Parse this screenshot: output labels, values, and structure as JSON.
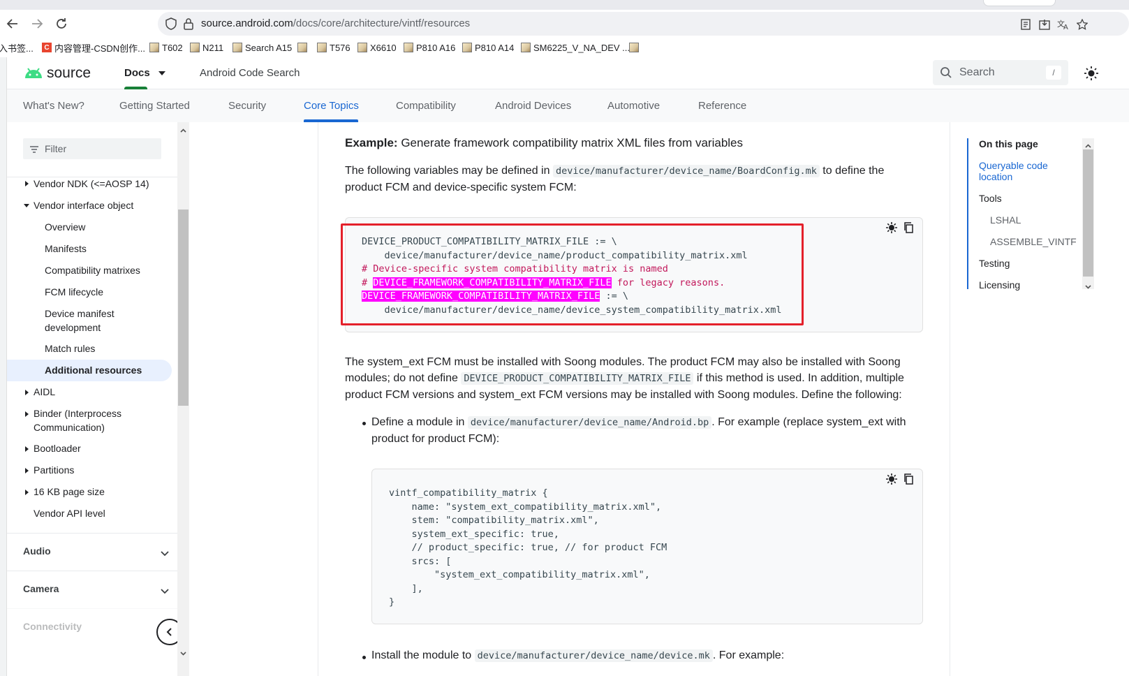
{
  "browser": {
    "url_host": "source.android.com",
    "url_path": "/docs/core/architecture/vintf/resources",
    "bookmarks": [
      {
        "label": "入书签...",
        "type": "plain"
      },
      {
        "label": "内容管理-CSDN创作...",
        "type": "csdn"
      },
      {
        "label": "T602",
        "type": "img"
      },
      {
        "label": "N211",
        "type": "img"
      },
      {
        "label": "Search A15",
        "type": "img"
      },
      {
        "label": "",
        "type": "img"
      },
      {
        "label": "T576",
        "type": "img"
      },
      {
        "label": "X6610",
        "type": "img"
      },
      {
        "label": "P810 A16",
        "type": "img"
      },
      {
        "label": "P810 A14",
        "type": "img"
      },
      {
        "label": "SM6225_V_NA_DEV ...",
        "type": "img"
      },
      {
        "label": "",
        "type": "img"
      }
    ]
  },
  "header": {
    "logo_text": "source",
    "docs_label": "Docs",
    "code_search": "Android Code Search",
    "search_placeholder": "Search",
    "search_shortcut": "/"
  },
  "topnav": {
    "items": [
      "What's New?",
      "Getting Started",
      "Security",
      "Core Topics",
      "Compatibility",
      "Android Devices",
      "Automotive",
      "Reference"
    ],
    "active": "Core Topics"
  },
  "sidebar": {
    "filter_placeholder": "Filter",
    "items": [
      {
        "label": "Vendor NDK (<=AOSP 14)"
      },
      {
        "label": "Vendor interface object"
      },
      {
        "label": "Overview"
      },
      {
        "label": "Manifests"
      },
      {
        "label": "Compatibility matrixes"
      },
      {
        "label": "FCM lifecycle"
      },
      {
        "label": "Device manifest development",
        "line1": "Device manifest",
        "line2": "development"
      },
      {
        "label": "Match rules"
      },
      {
        "label": "Additional resources"
      },
      {
        "label": "AIDL"
      },
      {
        "label": "Binder (Interprocess Communication)",
        "line1": "Binder (Interprocess",
        "line2": "Communication)"
      },
      {
        "label": "Bootloader"
      },
      {
        "label": "Partitions"
      },
      {
        "label": "16 KB page size"
      },
      {
        "label": "Vendor API level"
      }
    ],
    "sections": [
      "Audio",
      "Camera",
      "Connectivity"
    ]
  },
  "content": {
    "example_bold": "Example:",
    "example_text": " Generate framework compatibility matrix XML files from variables",
    "p1_a": "The following variables may be defined in ",
    "p1_code": "device/manufacturer/device_name/BoardConfig.mk",
    "p1_b": " to define the product FCM and device-specific system FCM:",
    "code1": {
      "line1": "DEVICE_PRODUCT_COMPATIBILITY_MATRIX_FILE := \\",
      "line2": "    device/manufacturer/device_name/product_compatibility_matrix.xml",
      "line3": "# Device-specific system compatibility matrix is named",
      "line4_a": "# ",
      "line4_hl": "DEVICE_FRAMEWORK_COMPATIBILITY_MATRIX_FILE",
      "line4_b": " for legacy reasons.",
      "line5_hl": "DEVICE_FRAMEWORK_COMPATIBILITY_MATRIX_FILE",
      "line5_b": " := \\",
      "line6": "    device/manufacturer/device_name/device_system_compatibility_matrix.xml"
    },
    "p2_a": "The system_ext FCM must be installed with Soong modules. The product FCM may also be installed with Soong modules; do not define ",
    "p2_code": "DEVICE_PRODUCT_COMPATIBILITY_MATRIX_FILE",
    "p2_b": " if this method is used. In addition, multiple product FCM versions and system_ext FCM versions may be installed with Soong modules. Define the following:",
    "b1_a": "Define a module in ",
    "b1_code": "device/manufacturer/device_name/Android.bp",
    "b1_b": ". For example (replace system_ext with product for product FCM):",
    "code2": "vintf_compatibility_matrix {\n    name: \"system_ext_compatibility_matrix.xml\",\n    stem: \"compatibility_matrix.xml\",\n    system_ext_specific: true,\n    // product_specific: true, // for product FCM\n    srcs: [\n        \"system_ext_compatibility_matrix.xml\",\n    ],\n}",
    "b2_a": "Install the module to ",
    "b2_code": "device/manufacturer/device_name/device.mk",
    "b2_b": ". For example:"
  },
  "toc": {
    "title": "On this page",
    "items": [
      "Queryable code location",
      "Tools",
      "LSHAL",
      "ASSEMBLE_VINTF",
      "Testing",
      "Licensing"
    ]
  },
  "colors": {
    "link_blue": "#1967d2",
    "android_green": "#3ddc84",
    "highlight_magenta": "#ff00ff",
    "comment_pink": "#c2185b",
    "red_annotation": "#e4202a"
  }
}
